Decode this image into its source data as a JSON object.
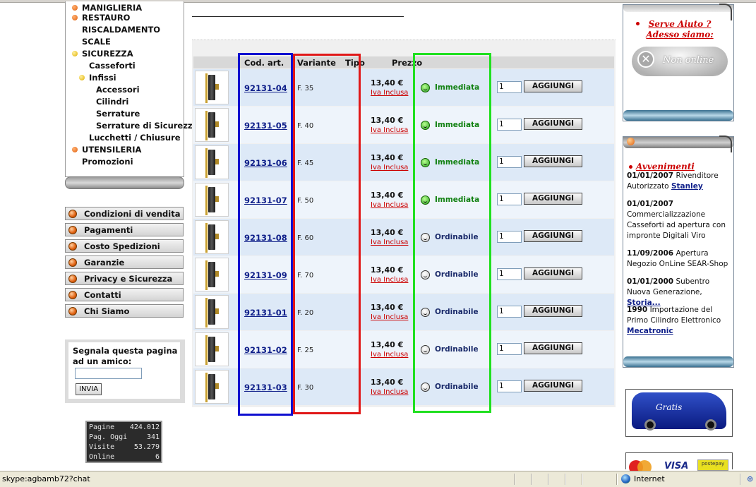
{
  "categories": [
    {
      "label": "MANIGLIERIA",
      "bullet": "orange",
      "indent": 0
    },
    {
      "label": "RESTAURO",
      "bullet": "orange",
      "indent": 0
    },
    {
      "label": "RISCALDAMENTO",
      "bullet": "none",
      "indent": 0
    },
    {
      "label": "SCALE",
      "bullet": "none",
      "indent": 0
    },
    {
      "label": "SICUREZZA",
      "bullet": "yellow",
      "indent": 0
    },
    {
      "label": "Casseforti",
      "bullet": "none",
      "indent": 1
    },
    {
      "label": "Infissi",
      "bullet": "yellow",
      "indent": 1
    },
    {
      "label": "Accessori",
      "bullet": "none",
      "indent": 2
    },
    {
      "label": "Cilindri",
      "bullet": "none",
      "indent": 2
    },
    {
      "label": "Serrature",
      "bullet": "none",
      "indent": 2
    },
    {
      "label": "Serrature di Sicurezza",
      "bullet": "none",
      "indent": 2
    },
    {
      "label": "Lucchetti / Chiusure",
      "bullet": "none",
      "indent": 1
    },
    {
      "label": "UTENSILERIA",
      "bullet": "orange",
      "indent": 0
    },
    {
      "label": "Promozioni",
      "bullet": "none",
      "indent": 0
    }
  ],
  "info_menu": [
    "Condizioni di vendita",
    "Pagamenti",
    "Costo Spedizioni",
    "Garanzie",
    "Privacy e Sicurezza",
    "Contatti",
    "Chi Siamo"
  ],
  "segnala": {
    "text": "Segnala questa pagina ad un amico:",
    "input_value": "",
    "button": "INVIA"
  },
  "counter": [
    {
      "label": "Pagine",
      "value": "424.012"
    },
    {
      "label": "Pag. Oggi",
      "value": "341"
    },
    {
      "label": "Visite",
      "value": "53.279"
    },
    {
      "label": "Online",
      "value": "6"
    }
  ],
  "table": {
    "headers": {
      "code": "Cod. art.",
      "variant": "Variante",
      "type": "Tipo",
      "price": "Prezzo"
    },
    "rows": [
      {
        "code": "92131-04",
        "variant": "F. 35",
        "price": "13,40 €",
        "iva": "Iva Inclusa",
        "availability": "Immediata",
        "status": "green",
        "qty": "1",
        "button": "AGGIUNGI"
      },
      {
        "code": "92131-05",
        "variant": "F. 40",
        "price": "13,40 €",
        "iva": "Iva Inclusa",
        "availability": "Immediata",
        "status": "green",
        "qty": "1",
        "button": "AGGIUNGI"
      },
      {
        "code": "92131-06",
        "variant": "F. 45",
        "price": "13,40 €",
        "iva": "Iva Inclusa",
        "availability": "Immediata",
        "status": "green",
        "qty": "1",
        "button": "AGGIUNGI"
      },
      {
        "code": "92131-07",
        "variant": "F. 50",
        "price": "13,40 €",
        "iva": "Iva Inclusa",
        "availability": "Immediata",
        "status": "green",
        "qty": "1",
        "button": "AGGIUNGI"
      },
      {
        "code": "92131-08",
        "variant": "F. 60",
        "price": "13,40 €",
        "iva": "Iva Inclusa",
        "availability": "Ordinabile",
        "status": "gray",
        "qty": "1",
        "button": "AGGIUNGI"
      },
      {
        "code": "92131-09",
        "variant": "F. 70",
        "price": "13,40 €",
        "iva": "Iva Inclusa",
        "availability": "Ordinabile",
        "status": "gray",
        "qty": "1",
        "button": "AGGIUNGI"
      },
      {
        "code": "92131-01",
        "variant": "F. 20",
        "price": "13,40 €",
        "iva": "Iva Inclusa",
        "availability": "Ordinabile",
        "status": "gray",
        "qty": "1",
        "button": "AGGIUNGI"
      },
      {
        "code": "92131-02",
        "variant": "F. 25",
        "price": "13,40 €",
        "iva": "Iva Inclusa",
        "availability": "Ordinabile",
        "status": "gray",
        "qty": "1",
        "button": "AGGIUNGI"
      },
      {
        "code": "92131-03",
        "variant": "F. 30",
        "price": "13,40 €",
        "iva": "Iva Inclusa",
        "availability": "Ordinabile",
        "status": "gray",
        "qty": "1",
        "button": "AGGIUNGI"
      }
    ]
  },
  "help_panel": {
    "line1": "Serve Aiuto ?",
    "line2": "Adesso siamo:",
    "status": "Non online"
  },
  "events_panel": {
    "title": "Avvenimenti",
    "items": [
      {
        "date": "01/01/2007",
        "text": "Rivenditore Autorizzato",
        "link": "Stanley"
      },
      {
        "date": "01/01/2007",
        "text": "Commercializzazione Casseforti ad apertura con impronte Digitali Viro",
        "link": ""
      },
      {
        "date": "11/09/2006",
        "text": "Apertura Negozio OnLine SEAR-Shop",
        "link": ""
      },
      {
        "date": "01/01/2000",
        "text": "Subentro Nuova Generazione,",
        "link": "Storia..."
      },
      {
        "date": "1990",
        "text": "Importazione del Primo Cilindro Elettronico",
        "link": "Mecatronic"
      }
    ]
  },
  "banner": {
    "van_text": "Gratis",
    "visa_text": "VISA",
    "card_text": "postepay"
  },
  "statusbar": {
    "text": "skype:agbamb72?chat",
    "zone": "Internet"
  },
  "colors": {
    "overlay_blue": "#1010d0",
    "overlay_red": "#e01818",
    "overlay_green": "#20e020",
    "link": "#10208a",
    "iva": "#cc0000"
  }
}
